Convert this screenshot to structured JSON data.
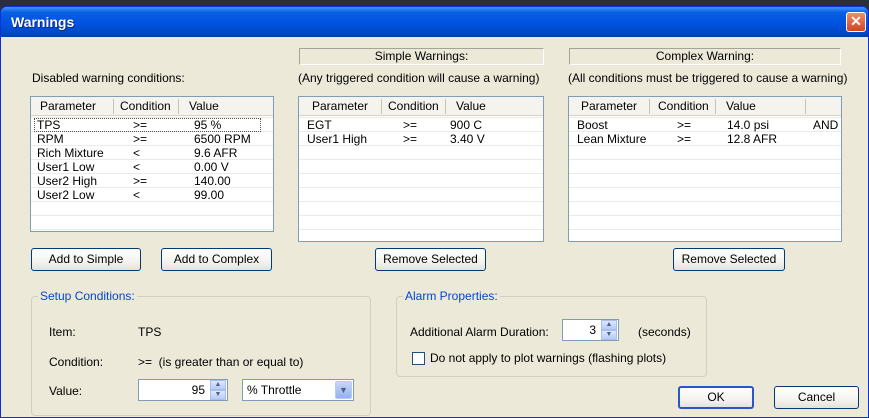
{
  "window": {
    "title": "Warnings",
    "close_glyph": "✕"
  },
  "disabled": {
    "label": "Disabled warning conditions:",
    "columns": [
      "Parameter",
      "Condition",
      "Value"
    ],
    "rows": [
      [
        "TPS",
        ">=",
        "95 %"
      ],
      [
        "RPM",
        ">=",
        "6500 RPM"
      ],
      [
        "Rich Mixture",
        "<",
        "9.6 AFR"
      ],
      [
        "User1 Low",
        "<",
        "0.00 V"
      ],
      [
        "User2 High",
        ">=",
        "140.00"
      ],
      [
        "User2 Low",
        "<",
        "99.00"
      ]
    ],
    "add_simple": "Add to Simple",
    "add_complex": "Add to Complex"
  },
  "simple": {
    "header": "Simple Warnings:",
    "subtitle": "(Any triggered condition will cause a warning)",
    "columns": [
      "Parameter",
      "Condition",
      "Value"
    ],
    "rows": [
      [
        "EGT",
        ">=",
        "900 C"
      ],
      [
        "User1 High",
        ">=",
        "3.40 V"
      ]
    ],
    "remove": "Remove Selected"
  },
  "complex": {
    "header": "Complex Warning:",
    "subtitle": "(All conditions must be triggered to cause a warning)",
    "columns": [
      "Parameter",
      "Condition",
      "Value"
    ],
    "rows": [
      [
        "Boost",
        ">=",
        "14.0 psi",
        "AND"
      ],
      [
        "Lean Mixture",
        ">=",
        "12.8 AFR",
        ""
      ]
    ],
    "remove": "Remove Selected"
  },
  "setup": {
    "legend": "Setup Conditions:",
    "item_label": "Item:",
    "item_value": "TPS",
    "condition_label": "Condition:",
    "condition_value": ">=  (is greater than or equal to)",
    "value_label": "Value:",
    "value": "95",
    "unit_selected": "% Throttle"
  },
  "alarm": {
    "legend": "Alarm Properties:",
    "duration_label": "Additional Alarm Duration:",
    "duration_value": "3",
    "duration_unit": "(seconds)",
    "checkbox_label": "Do not apply to plot warnings (flashing plots)",
    "checkbox_checked": false
  },
  "footer": {
    "ok": "OK",
    "cancel": "Cancel"
  }
}
